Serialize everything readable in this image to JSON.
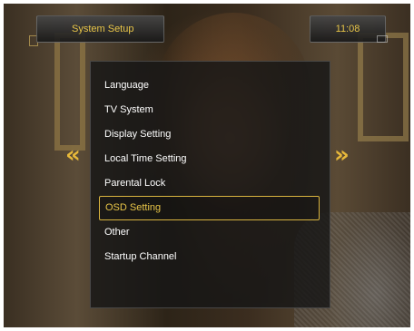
{
  "header": {
    "title": "System Setup",
    "clock": "11:08"
  },
  "menu": {
    "items": [
      {
        "label": "Language",
        "selected": false
      },
      {
        "label": "TV System",
        "selected": false
      },
      {
        "label": "Display Setting",
        "selected": false
      },
      {
        "label": "Local Time Setting",
        "selected": false
      },
      {
        "label": "Parental Lock",
        "selected": false
      },
      {
        "label": "OSD Setting",
        "selected": true
      },
      {
        "label": "Other",
        "selected": false
      },
      {
        "label": "Startup Channel",
        "selected": false
      }
    ]
  },
  "nav": {
    "left_icon": "double-chevron-left-icon",
    "right_icon": "double-chevron-right-icon"
  },
  "colors": {
    "accent": "#e8c548",
    "menu_text": "#ffffff",
    "panel_bg": "#161616"
  }
}
